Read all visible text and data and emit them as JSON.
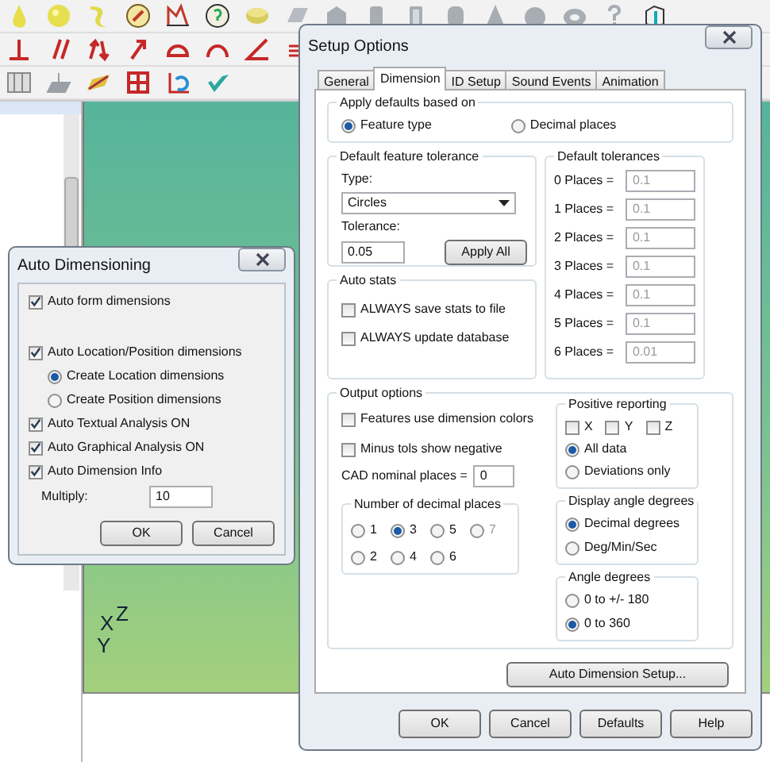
{
  "viewport": {
    "axes": [
      {
        "label": "X"
      },
      {
        "label": "Z"
      },
      {
        "label": "Y"
      }
    ]
  },
  "auto_dimensioning": {
    "title": "Auto Dimensioning",
    "options": [
      {
        "kind": "checkbox",
        "label": "Auto form dimensions",
        "checked": true
      },
      {
        "kind": "spacer"
      },
      {
        "kind": "checkbox",
        "label": "Auto Location/Position dimensions",
        "checked": true
      },
      {
        "kind": "radio",
        "label": "Create Location dimensions",
        "selected": true
      },
      {
        "kind": "radio",
        "label": "Create Position dimensions",
        "selected": false
      },
      {
        "kind": "checkbox",
        "label": "Auto Textual Analysis ON",
        "checked": true
      },
      {
        "kind": "checkbox",
        "label": "Auto Graphical Analysis ON",
        "checked": true
      },
      {
        "kind": "checkbox",
        "label": "Auto Dimension Info",
        "checked": true
      }
    ],
    "multiply": {
      "label": "Multiply:",
      "value": "10"
    },
    "buttons": [
      "OK",
      "Cancel"
    ]
  },
  "setup_options": {
    "title": "Setup Options",
    "tabs": [
      {
        "label": "General",
        "selected": false
      },
      {
        "label": "Dimension",
        "selected": true
      },
      {
        "label": "ID Setup",
        "selected": false
      },
      {
        "label": "Sound Events",
        "selected": false
      },
      {
        "label": "Animation",
        "selected": false
      }
    ],
    "apply_defaults": {
      "title": "Apply defaults based on",
      "options": [
        {
          "label": "Feature type",
          "selected": true
        },
        {
          "label": "Decimal places",
          "selected": false
        }
      ]
    },
    "feature_tolerance": {
      "title": "Default feature tolerance",
      "type_label": "Type:",
      "type_value": "Circles",
      "tolerance_label": "Tolerance:",
      "tolerance_value": "0.05",
      "button": "Apply All"
    },
    "default_tolerances": {
      "title": "Default tolerances",
      "rows": [
        {
          "label": "0 Places =",
          "value": "0.1",
          "disabled": true
        },
        {
          "label": "1 Places =",
          "value": "0.1",
          "disabled": true
        },
        {
          "label": "2 Places =",
          "value": "0.1",
          "disabled": true
        },
        {
          "label": "3 Places =",
          "value": "0.1",
          "disabled": true
        },
        {
          "label": "4 Places =",
          "value": "0.1",
          "disabled": true
        },
        {
          "label": "5 Places =",
          "value": "0.1",
          "disabled": true
        },
        {
          "label": "6 Places =",
          "value": "0.01",
          "disabled": true
        }
      ]
    },
    "auto_stats": {
      "title": "Auto stats",
      "options": [
        {
          "label": "ALWAYS save stats to file",
          "checked": false
        },
        {
          "label": "ALWAYS update database",
          "checked": false
        }
      ]
    },
    "output_options": {
      "title": "Output options",
      "options": [
        {
          "label": "Features use dimension colors",
          "checked": false
        },
        {
          "label": "Minus tols show negative",
          "checked": false
        }
      ],
      "cad_nominal": {
        "label": "CAD nominal places =",
        "value": "0"
      },
      "decimal_places": {
        "title": "Number of decimal places",
        "options": [
          {
            "label": "1",
            "selected": false,
            "disabled": false
          },
          {
            "label": "3",
            "selected": true,
            "disabled": false
          },
          {
            "label": "5",
            "selected": false,
            "disabled": false
          },
          {
            "label": "7",
            "selected": false,
            "disabled": true
          },
          {
            "label": "2",
            "selected": false,
            "disabled": false
          },
          {
            "label": "4",
            "selected": false,
            "disabled": false
          },
          {
            "label": "6",
            "selected": false,
            "disabled": false
          }
        ]
      },
      "positive_reporting": {
        "title": "Positive reporting",
        "axes": [
          {
            "label": "X",
            "checked": false
          },
          {
            "label": "Y",
            "checked": false
          },
          {
            "label": "Z",
            "checked": false
          }
        ],
        "modes": [
          {
            "label": "All data",
            "selected": true
          },
          {
            "label": "Deviations only",
            "selected": false
          }
        ]
      },
      "display_angle": {
        "title": "Display angle degrees",
        "options": [
          {
            "label": "Decimal degrees",
            "selected": true
          },
          {
            "label": "Deg/Min/Sec",
            "selected": false
          }
        ]
      },
      "angle_degrees": {
        "title": "Angle degrees",
        "options": [
          {
            "label": "0 to +/- 180",
            "selected": false
          },
          {
            "label": "0 to 360",
            "selected": true
          }
        ]
      }
    },
    "setup_button": "Auto Dimension Setup...",
    "buttons": [
      "OK",
      "Cancel",
      "Defaults",
      "Help"
    ]
  }
}
